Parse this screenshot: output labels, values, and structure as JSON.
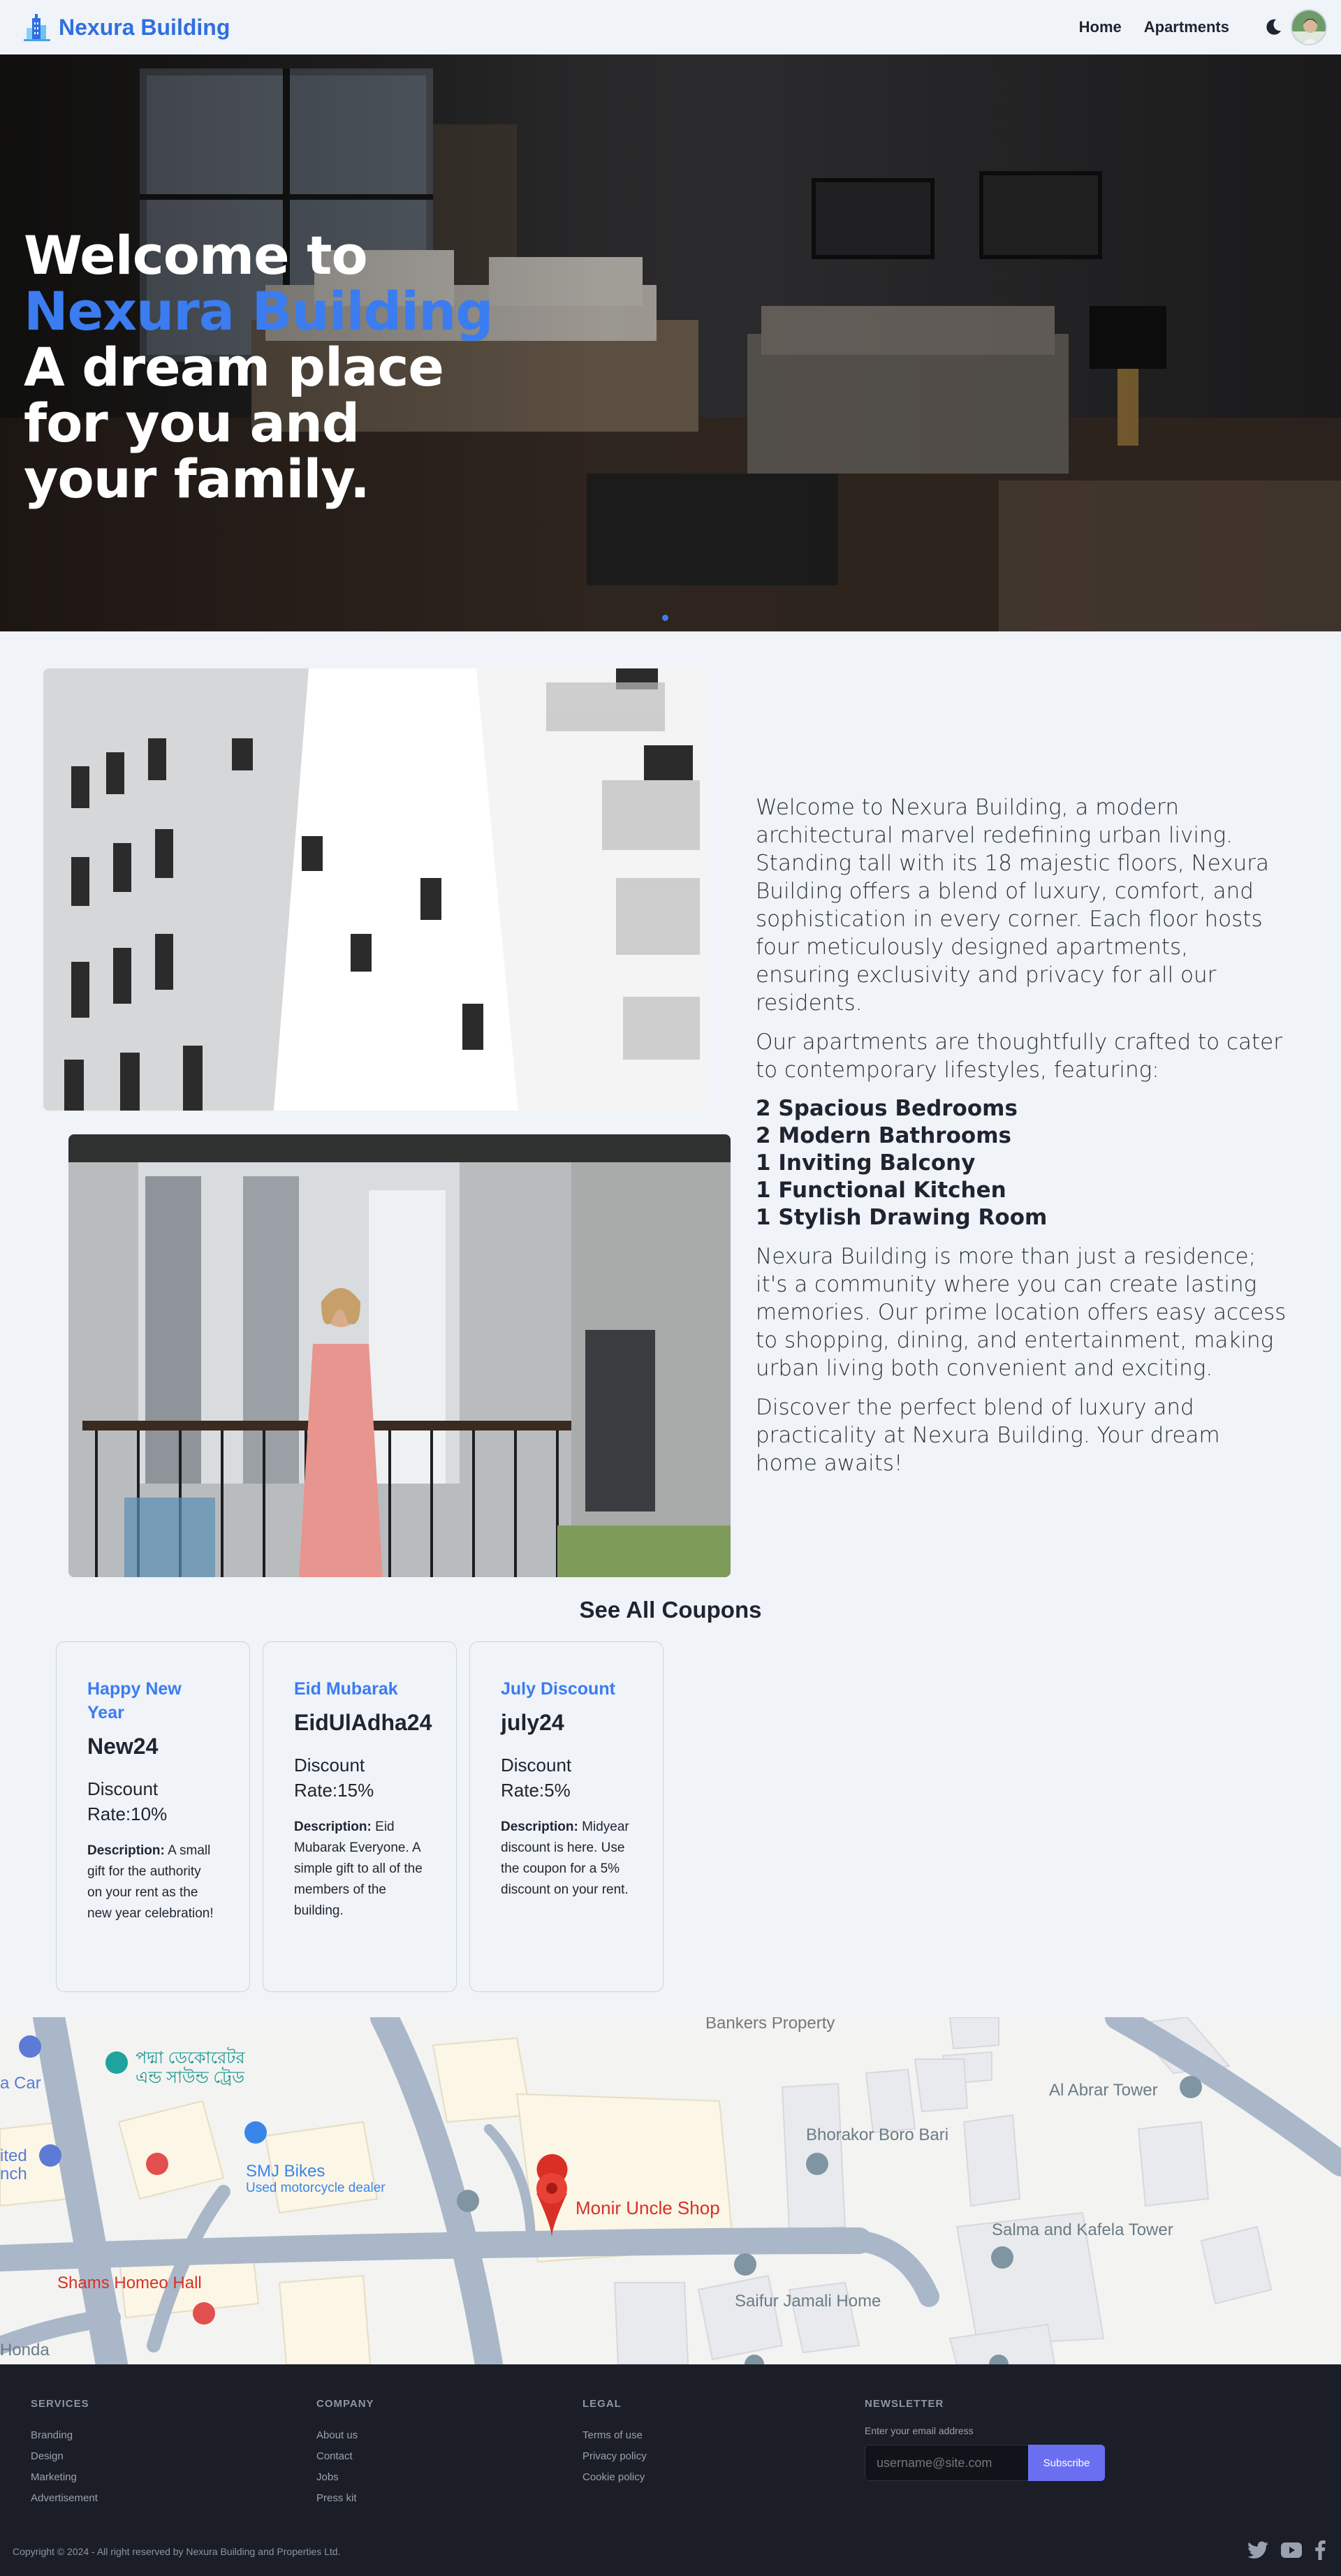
{
  "nav": {
    "brand": "Nexura Building",
    "links": [
      "Home",
      "Apartments"
    ],
    "theme_icon": "moon-icon",
    "avatar_icon": "user-avatar"
  },
  "hero": {
    "line1": "Welcome to",
    "accent": "Nexura Building",
    "line2": "A dream place for you and your family."
  },
  "about": {
    "para1": "Welcome to Nexura Building, a modern architectural marvel redefining urban living. Standing tall with its 18 majestic floors, Nexura Building offers a blend of luxury, comfort, and sophistication in every corner. Each floor hosts four meticulously designed apartments, ensuring exclusivity and privacy for all our residents.",
    "para2": "Our apartments are thoughtfully crafted to cater to contemporary lifestyles, featuring:",
    "features": [
      "2 Spacious Bedrooms",
      "2 Modern Bathrooms",
      "1 Inviting Balcony",
      "1 Functional Kitchen",
      "1 Stylish Drawing Room"
    ],
    "para3": "Nexura Building is more than just a residence; it's a community where you can create lasting memories. Our prime location offers easy access to shopping, dining, and entertainment, making urban living both convenient and exciting.",
    "para4": "Discover the perfect blend of luxury and practicality at Nexura Building. Your dream home awaits!"
  },
  "coupons": {
    "title": "See All Coupons",
    "desc_label": "Description:",
    "items": [
      {
        "name": "Happy New Year",
        "code": "New24",
        "rate": "Discount Rate:10%",
        "desc": "A small gift for the authority on your rent as the new year celebration!"
      },
      {
        "name": "Eid Mubarak",
        "code": "EidUlAdha24",
        "rate": "Discount Rate:15%",
        "desc": "Eid Mubarak Everyone. A simple gift to all of the members of the building."
      },
      {
        "name": "July Discount",
        "code": "july24",
        "rate": "Discount Rate:5%",
        "desc": "Midyear discount is here. Use the coupon for a 5% discount on your rent."
      }
    ]
  },
  "map": {
    "labels": {
      "bankers": "Bankers Property",
      "padma": "পদ্মা ডেকোরেটর",
      "padma2": "এন্ড সাউন্ড ট্রেড",
      "acar": "a Car",
      "alabrar": "Al Abrar Tower",
      "bhorakor": "Bhorakor Boro Bari",
      "ited": "ited",
      "nch": "nch",
      "smj": "SMJ Bikes",
      "smj_sub": "Used motorcycle dealer",
      "monir": "Monir Uncle Shop",
      "salma": "Salma and Kafela Tower",
      "shams": "Shams Homeo Hall",
      "saifur": "Saifur Jamali Home",
      "honda": "Honda"
    }
  },
  "footer": {
    "services": {
      "head": "SERVICES",
      "links": [
        "Branding",
        "Design",
        "Marketing",
        "Advertisement"
      ]
    },
    "company": {
      "head": "COMPANY",
      "links": [
        "About us",
        "Contact",
        "Jobs",
        "Press kit"
      ]
    },
    "legal": {
      "head": "LEGAL",
      "links": [
        "Terms of use",
        "Privacy policy",
        "Cookie policy"
      ]
    },
    "newsletter": {
      "head": "NEWSLETTER",
      "label": "Enter your email address",
      "placeholder": "username@site.com",
      "button": "Subscribe"
    },
    "copyright": "Copyright © 2024 - All right reserved by Nexura Building and Properties Ltd.",
    "social_icons": [
      "twitter-icon",
      "youtube-icon",
      "facebook-icon"
    ]
  }
}
